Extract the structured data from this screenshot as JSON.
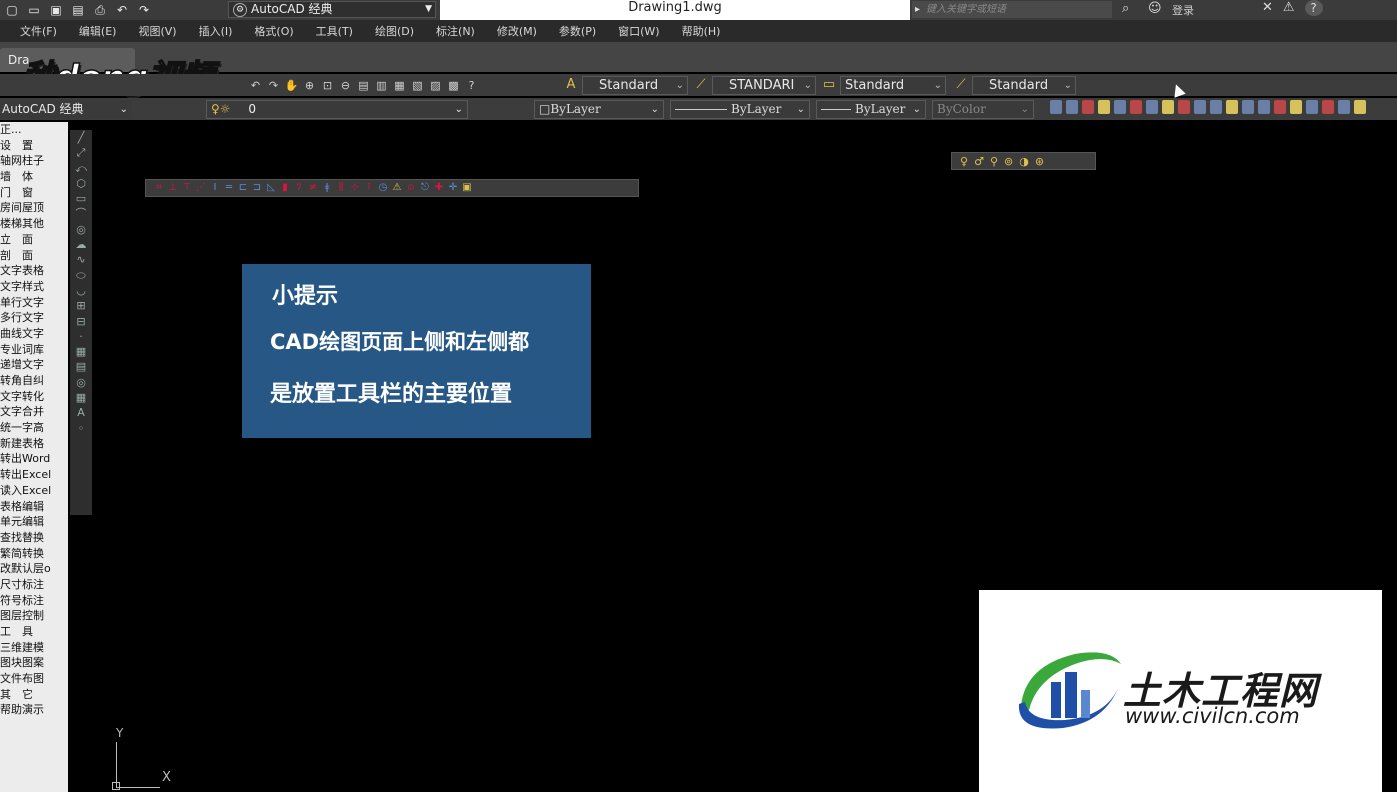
{
  "titlebar": {
    "workspace": "AutoCAD 经典",
    "doc_title": "Drawing1.dwg",
    "search_placeholder": "键入关键字或短语",
    "login": "登录"
  },
  "menu": [
    "文件(F)",
    "编辑(E)",
    "视图(V)",
    "插入(I)",
    "格式(O)",
    "工具(T)",
    "绘图(D)",
    "标注(N)",
    "修改(M)",
    "参数(P)",
    "窗口(W)",
    "帮助(H)"
  ],
  "tab": {
    "label": "Dra"
  },
  "watermark_logo": "秒dong视频",
  "styles": {
    "text_style": "Standard",
    "dim_style": "STANDARI",
    "table_style": "Standard",
    "mleader_style": "Standard"
  },
  "toolbar2": {
    "workspace": "AutoCAD 经典",
    "layer": "0",
    "color": "ByLayer",
    "linetype": "ByLayer",
    "lineweight": "ByLayer",
    "plotstyle": "ByColor"
  },
  "palette": {
    "items": [
      "正...",
      "设　置",
      "轴网柱子",
      "墙　体",
      "门　窗",
      "房间屋顶",
      "楼梯其他",
      "立　面",
      "剖　面",
      "文字表格",
      "文字样式",
      "单行文字",
      "多行文字",
      "曲线文字",
      "专业词库",
      "递增文字",
      "转角自纠",
      "文字转化",
      "文字合并",
      "统一字高",
      "新建表格",
      "转出Word",
      "转出Excel",
      "读入Excel",
      "表格编辑",
      "单元编辑",
      "查找替换",
      "繁简转换",
      "改默认层o",
      "尺寸标注",
      "符号标注",
      "图层控制",
      "工　具",
      "三维建模",
      "图块图案",
      "文件布图",
      "其　它",
      "帮助演示"
    ]
  },
  "tip": {
    "title": "小提示",
    "line1": "CAD绘图页面上侧和左侧都",
    "line2": "是放置工具栏的主要位置"
  },
  "ucs": {
    "x": "X",
    "y": "Y"
  },
  "civil_logo": {
    "cn": "土木工程网",
    "url": "www.civilcn.com"
  }
}
